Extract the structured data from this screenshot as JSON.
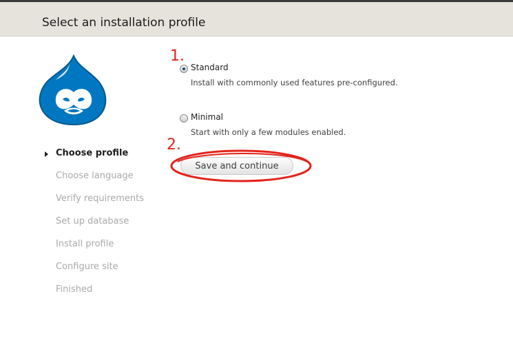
{
  "header": {
    "title": "Select an installation profile"
  },
  "steps": [
    {
      "label": "Choose profile",
      "active": true
    },
    {
      "label": "Choose language",
      "active": false
    },
    {
      "label": "Verify requirements",
      "active": false
    },
    {
      "label": "Set up database",
      "active": false
    },
    {
      "label": "Install profile",
      "active": false
    },
    {
      "label": "Configure site",
      "active": false
    },
    {
      "label": "Finished",
      "active": false
    }
  ],
  "profiles": [
    {
      "label": "Standard",
      "description": "Install with commonly used features pre-configured.",
      "selected": true
    },
    {
      "label": "Minimal",
      "description": "Start with only a few modules enabled.",
      "selected": false
    }
  ],
  "form": {
    "submit_label": "Save and continue"
  },
  "annotations": {
    "step1": "1.",
    "step2": "2.",
    "color": "#e2231a"
  },
  "colors": {
    "header_bg": "#e5e3dc",
    "logo_blue": "#0077c0",
    "inactive_step": "#a9a9a9"
  }
}
